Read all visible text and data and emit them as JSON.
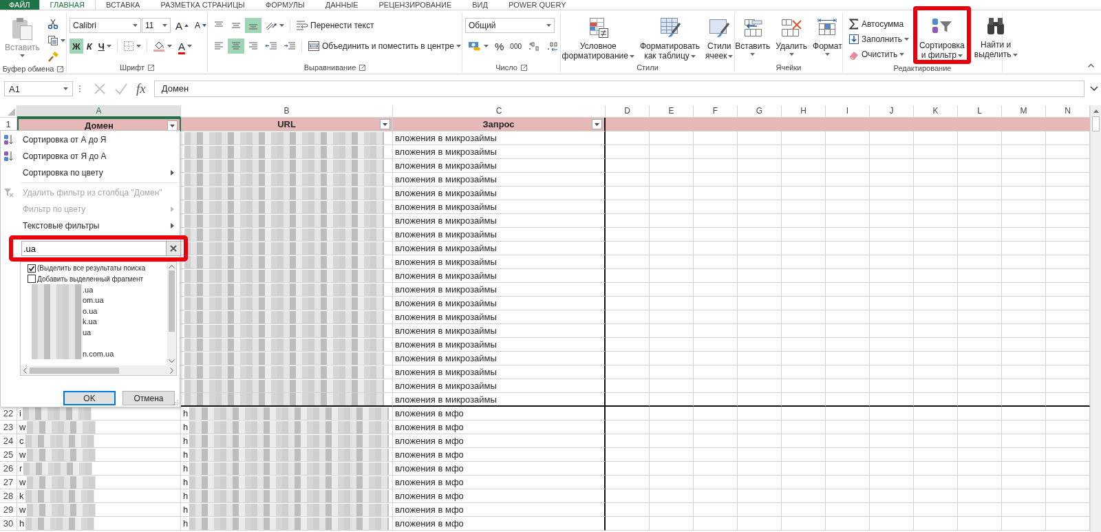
{
  "ribbon_tabs": [
    {
      "label": "ФАЙЛ",
      "kind": "file",
      "selected": false
    },
    {
      "label": "ГЛАВНАЯ",
      "kind": "tab",
      "selected": true
    },
    {
      "label": "ВСТАВКА",
      "kind": "tab",
      "selected": false
    },
    {
      "label": "РАЗМЕТКА СТРАНИЦЫ",
      "kind": "tab",
      "selected": false
    },
    {
      "label": "ФОРМУЛЫ",
      "kind": "tab",
      "selected": false
    },
    {
      "label": "ДАННЫЕ",
      "kind": "tab",
      "selected": false
    },
    {
      "label": "РЕЦЕНЗИРОВАНИЕ",
      "kind": "tab",
      "selected": false
    },
    {
      "label": "ВИД",
      "kind": "tab",
      "selected": false
    },
    {
      "label": "POWER QUERY",
      "kind": "tab",
      "selected": false
    }
  ],
  "clipboard": {
    "label": "Буфер обмена",
    "paste": "Вставить"
  },
  "font": {
    "label": "Шрифт",
    "name": "Calibri",
    "size": "11",
    "grow": "A",
    "shrink": "A",
    "font_color": "A",
    "styles": [
      {
        "label": "Ж",
        "kind": "bold",
        "selected": true
      },
      {
        "label": "К",
        "kind": "italic",
        "selected": false
      },
      {
        "label": "Ч",
        "kind": "underline",
        "selected": false
      }
    ]
  },
  "alignment": {
    "label": "Выравнивание",
    "wrap_text": "Перенести текст",
    "merge": "Объединить и поместить в центре",
    "vertical": [
      {
        "kind": "top",
        "selected": false
      },
      {
        "kind": "middle",
        "selected": false
      },
      {
        "kind": "bottom",
        "selected": true
      }
    ],
    "horizontal": [
      {
        "kind": "left",
        "selected": false
      },
      {
        "kind": "center",
        "selected": true
      },
      {
        "kind": "right",
        "selected": false
      }
    ]
  },
  "number": {
    "label": "Число",
    "format": "Общий",
    "percent": "%",
    "thousands": "000"
  },
  "styles": {
    "label": "Стили",
    "buttons": [
      {
        "kind": "conditional",
        "label": "Условное\nформатирование"
      },
      {
        "kind": "table",
        "label": "Форматировать\nкак таблицу"
      },
      {
        "kind": "cell_styles",
        "label": "Стили\nячеек"
      }
    ]
  },
  "cells": {
    "label": "Ячейки",
    "buttons": [
      {
        "kind": "insert",
        "label": "Вставить"
      },
      {
        "kind": "delete",
        "label": "Удалить"
      },
      {
        "kind": "format",
        "label": "Формат"
      }
    ]
  },
  "editing": {
    "label": "Редактирование",
    "small": [
      {
        "kind": "autosum",
        "label": "Автосумма"
      },
      {
        "kind": "fill",
        "label": "Заполнить"
      },
      {
        "kind": "clear",
        "label": "Очистить"
      }
    ],
    "buttons": [
      {
        "kind": "sort",
        "label": "Сортировка\nи фильтр",
        "highlighted": true
      },
      {
        "kind": "find",
        "label": "Найти и\nвыделить",
        "highlighted": false
      }
    ]
  },
  "formula_bar": {
    "name_box": "A1",
    "fx": "fx",
    "value": "Домен"
  },
  "columns": [
    {
      "letter": "A",
      "selected": true
    },
    {
      "letter": "B",
      "selected": false
    },
    {
      "letter": "C",
      "selected": false
    },
    {
      "letter": "D",
      "selected": false
    },
    {
      "letter": "E",
      "selected": false
    },
    {
      "letter": "F",
      "selected": false
    },
    {
      "letter": "G",
      "selected": false
    },
    {
      "letter": "H",
      "selected": false
    },
    {
      "letter": "I",
      "selected": false
    },
    {
      "letter": "J",
      "selected": false
    },
    {
      "letter": "K",
      "selected": false
    },
    {
      "letter": "L",
      "selected": false
    },
    {
      "letter": "M",
      "selected": false
    },
    {
      "letter": "N",
      "selected": false
    }
  ],
  "rows": [
    {
      "num": "1",
      "kind": "header",
      "cells": [
        {
          "text": "Домен",
          "filter": true
        },
        {
          "text": "URL",
          "filter": true
        },
        {
          "text": "Запрос",
          "filter": true
        }
      ]
    },
    {
      "kind": "data",
      "query": "вложения в микрозаймы"
    },
    {
      "kind": "data",
      "query": "вложения в микрозаймы"
    },
    {
      "kind": "data",
      "query": "вложения в микрозаймы"
    },
    {
      "kind": "data",
      "query": "вложения в микрозаймы"
    },
    {
      "kind": "data",
      "query": "вложения в микрозаймы"
    },
    {
      "kind": "data",
      "query": "вложения в микрозаймы"
    },
    {
      "kind": "data",
      "query": "вложения в микрозаймы"
    },
    {
      "kind": "data",
      "query": "вложения в микрозаймы"
    },
    {
      "kind": "data",
      "query": "вложения в микрозаймы"
    },
    {
      "kind": "data",
      "query": "вложения в микрозаймы"
    },
    {
      "kind": "data",
      "query": "вложения в микрозаймы"
    },
    {
      "kind": "data",
      "query": "вложения в микрозаймы"
    },
    {
      "kind": "data",
      "query": "вложения в микрозаймы"
    },
    {
      "kind": "data",
      "query": "вложения в микрозаймы"
    },
    {
      "kind": "data",
      "query": "вложения в микрозаймы"
    },
    {
      "kind": "data",
      "query": "вложения в микрозаймы"
    },
    {
      "kind": "data",
      "query": "вложения в микрозаймы"
    },
    {
      "kind": "data",
      "query": "вложения в микрозаймы"
    },
    {
      "kind": "data",
      "query": "вложения в микрозаймы"
    },
    {
      "kind": "data",
      "query": "вложения в микрозаймы"
    },
    {
      "num": "22",
      "kind": "data",
      "domain": "i",
      "url": "h",
      "query": "вложения в мфо"
    },
    {
      "num": "23",
      "kind": "data",
      "domain": "w",
      "url": "h",
      "query": "вложения в мфо"
    },
    {
      "num": "24",
      "kind": "data",
      "domain": "c",
      "url": "h",
      "query": "вложения в мфо"
    },
    {
      "num": "25",
      "kind": "data",
      "domain": "w",
      "url": "h",
      "query": "вложения в мфо"
    },
    {
      "num": "26",
      "kind": "data",
      "domain": "r",
      "url": "h",
      "query": "вложения в мфо"
    },
    {
      "num": "27",
      "kind": "data",
      "domain": "w",
      "url": "h",
      "query": "вложения в мфо"
    },
    {
      "num": "28",
      "kind": "data",
      "domain": "k",
      "url": "h",
      "query": "вложения в мфо"
    },
    {
      "num": "29",
      "kind": "data",
      "domain": "w",
      "url": "h",
      "query": "вложения в мфо"
    },
    {
      "num": "30",
      "kind": "data",
      "domain": "h",
      "url": "h",
      "query": "вложения в мфо"
    }
  ],
  "filter_menu": {
    "items": [
      {
        "kind": "sort_az",
        "label": "Сортировка от А до Я",
        "disabled": false
      },
      {
        "kind": "sort_za",
        "label": "Сортировка от Я до А",
        "disabled": false
      },
      {
        "kind": "submenu",
        "label": "Сортировка по цвету",
        "disabled": false
      },
      {
        "kind": "separator"
      },
      {
        "kind": "clear_filter",
        "label": "Удалить фильтр из столбца \"Домен\"",
        "disabled": true
      },
      {
        "kind": "submenu",
        "label": "Фильтр по цвету",
        "disabled": true
      },
      {
        "kind": "submenu",
        "label": "Текстовые фильтры",
        "disabled": false
      }
    ],
    "search": {
      "value": ".ua",
      "highlighted": true
    },
    "options": [
      {
        "label": "(Выделить все результаты поиска",
        "checked": true
      },
      {
        "label": "Добавить выделенный фрагмент",
        "checked": false
      }
    ],
    "values": [
      {
        "text": ".ua",
        "redacted": true
      },
      {
        "text": "om.ua",
        "redacted": true
      },
      {
        "text": "o.ua",
        "redacted": true
      },
      {
        "text": "k.ua",
        "redacted": true
      },
      {
        "text": "ua",
        "redacted": true
      },
      {
        "redacted": true
      },
      {
        "text": "n.com.ua",
        "redacted": true
      }
    ],
    "buttons": [
      {
        "label": "OK",
        "selected": true
      },
      {
        "label": "Отмена",
        "selected": false
      }
    ]
  }
}
